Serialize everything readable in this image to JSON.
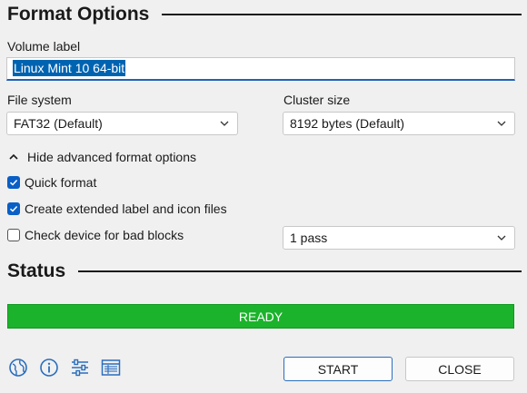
{
  "format_options": {
    "title": "Format Options",
    "volume_label": {
      "label": "Volume label",
      "value": "Linux Mint 10 64-bit"
    },
    "file_system": {
      "label": "File system",
      "value": "FAT32 (Default)"
    },
    "cluster_size": {
      "label": "Cluster size",
      "value": "8192 bytes (Default)"
    },
    "advanced_toggle": "Hide advanced format options",
    "quick_format": {
      "label": "Quick format",
      "checked": true
    },
    "extended_label": {
      "label": "Create extended label and icon files",
      "checked": true
    },
    "bad_blocks": {
      "label": "Check device for bad blocks",
      "checked": false,
      "passes": "1 pass"
    }
  },
  "status": {
    "title": "Status",
    "progress_text": "READY",
    "progress_fraction": 1.0,
    "progress_color": "#1bb32b"
  },
  "toolbar": {
    "icons": [
      "globe-icon",
      "info-icon",
      "settings-sliders-icon",
      "log-icon"
    ]
  },
  "actions": {
    "start": "START",
    "close": "CLOSE"
  },
  "colors": {
    "accent": "#0063b1",
    "checkbox": "#0a5fc6"
  }
}
